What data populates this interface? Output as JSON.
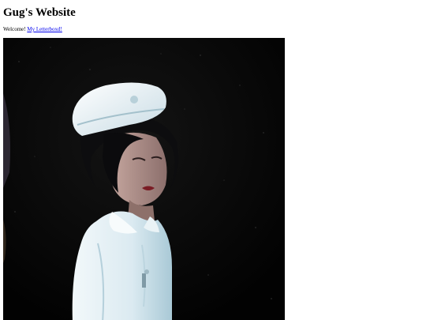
{
  "page": {
    "title": "Gug's Website",
    "welcome_text": "Welcome!",
    "letterboxd_link": "My Letterboxd!"
  },
  "colors": {
    "link": "#0000ee",
    "photo_background": "#030303",
    "uniform": "#e8f1f5"
  }
}
